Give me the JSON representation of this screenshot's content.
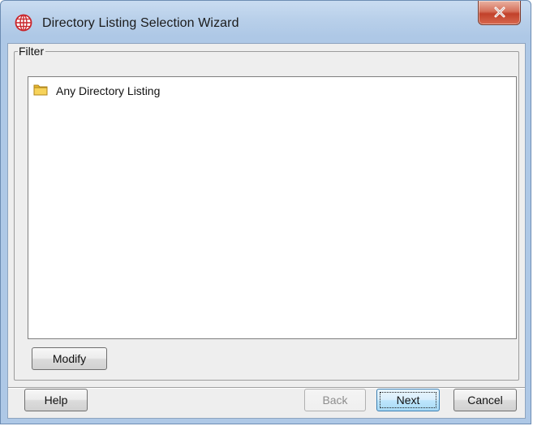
{
  "window": {
    "title": "Directory Listing Selection Wizard",
    "app_icon": "globe-icon",
    "close_icon": "close-icon"
  },
  "filter": {
    "legend": "Filter",
    "items": [
      {
        "label": "Any Directory Listing",
        "icon": "folder-icon"
      }
    ],
    "modify_label": "Modify"
  },
  "footer": {
    "help_label": "Help",
    "back_label": "Back",
    "next_label": "Next",
    "cancel_label": "Cancel"
  },
  "colors": {
    "titlebar": "#b9d0ea",
    "close_button": "#c1412a",
    "client_bg": "#eeeeee",
    "focused_button": "#bee6fd",
    "app_icon": "#c9252b"
  }
}
